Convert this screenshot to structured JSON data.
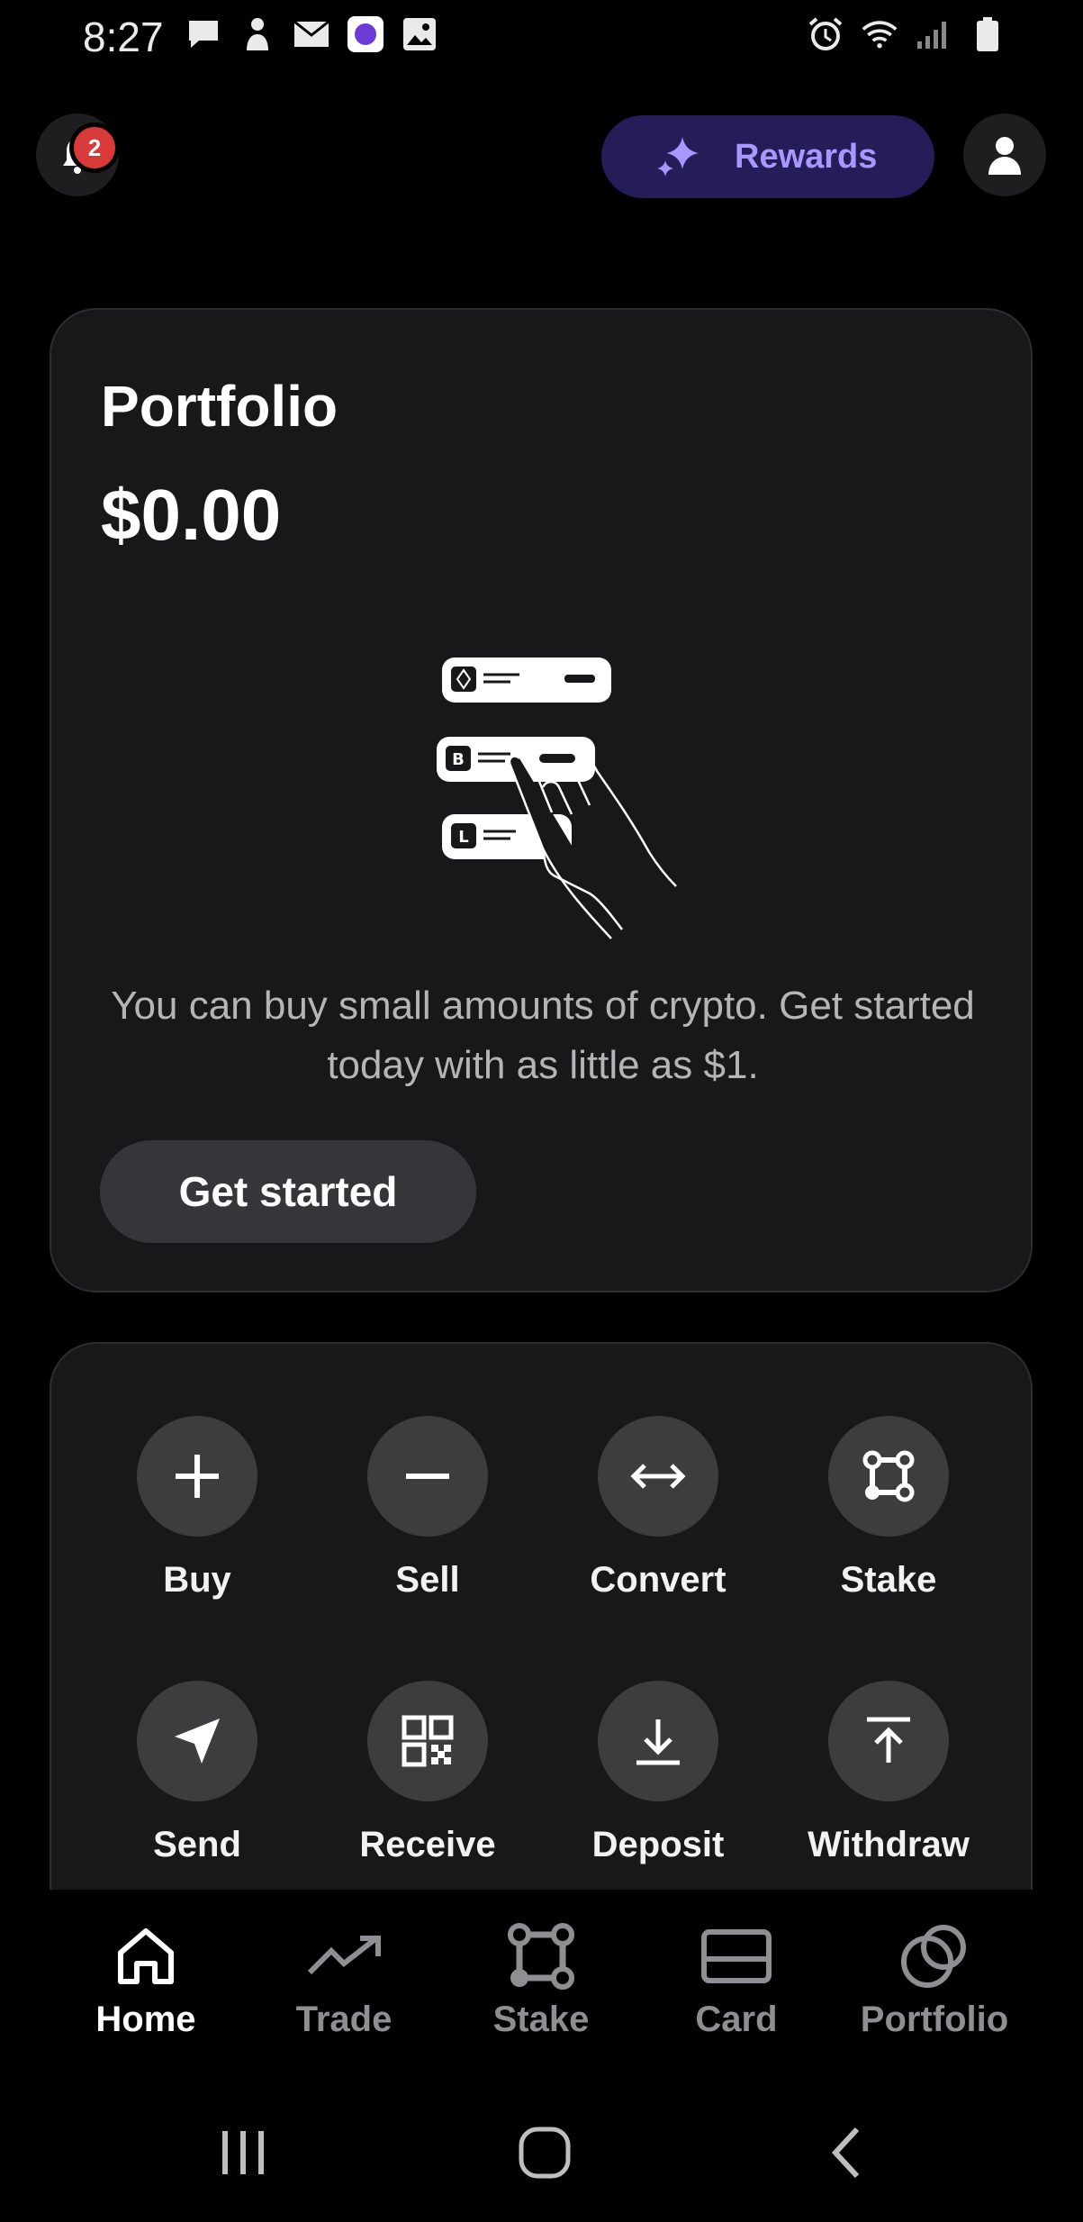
{
  "status_bar": {
    "time": "8:27",
    "left_icons": [
      "message-icon",
      "person-icon",
      "mail-icon",
      "app-icon",
      "gallery-icon"
    ],
    "right_icons": [
      "alarm-icon",
      "wifi-icon",
      "signal-icon",
      "battery-icon"
    ]
  },
  "header": {
    "notification_count": "2",
    "rewards_label": "Rewards"
  },
  "portfolio": {
    "title": "Portfolio",
    "value": "$0.00",
    "message": "You can buy small amounts of crypto. Get started today with as little as $1.",
    "cta": "Get started"
  },
  "actions": [
    {
      "label": "Buy",
      "icon": "plus-icon"
    },
    {
      "label": "Sell",
      "icon": "minus-icon"
    },
    {
      "label": "Convert",
      "icon": "arrows-horizontal-icon"
    },
    {
      "label": "Stake",
      "icon": "stake-icon"
    },
    {
      "label": "Send",
      "icon": "send-icon"
    },
    {
      "label": "Receive",
      "icon": "qr-code-icon"
    },
    {
      "label": "Deposit",
      "icon": "deposit-icon"
    },
    {
      "label": "Withdraw",
      "icon": "withdraw-icon"
    }
  ],
  "bottom_nav": [
    {
      "label": "Home",
      "icon": "home-icon",
      "active": true
    },
    {
      "label": "Trade",
      "icon": "trend-icon",
      "active": false
    },
    {
      "label": "Stake",
      "icon": "stake-icon",
      "active": false
    },
    {
      "label": "Card",
      "icon": "card-icon",
      "active": false
    },
    {
      "label": "Portfolio",
      "icon": "portfolio-icon",
      "active": false
    }
  ],
  "colors": {
    "background": "#000000",
    "card": "#18181a",
    "accent": "#a996ff",
    "badge": "#d83a3a"
  }
}
